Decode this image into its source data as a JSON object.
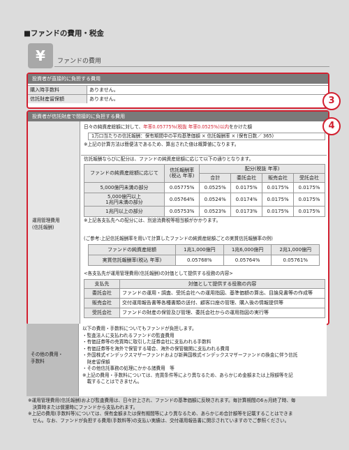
{
  "section_title": "■ファンドの費用・税金",
  "icon": "yen-icon",
  "fee_heading": "ファンドの費用",
  "direct": {
    "header": "投資者が直接的に負担する費用",
    "rows": [
      {
        "label": "購入時手数料",
        "value": "ありません。"
      },
      {
        "label": "信託財産留保額",
        "value": "ありません。"
      }
    ],
    "badge": "3"
  },
  "indirect": {
    "header": "投資者が信託財産で間接的に負担する費用",
    "badge": "4",
    "left_label": "運用管理費用\n(信託報酬)",
    "line1_pre": "日々の純資産総額に対して、",
    "line1_red": "年率0.05775%(税抜 年率0.0525%)以内",
    "line1_post": "をかけた額",
    "formula": "1万口当たりの信託報酬：保有期間中の平均基準価額 × 信託報酬率 × (保有日数／ 365)",
    "note1": "※上記の計算方法は簡便法であるため、算出された値は概算値になります。",
    "note2": "信託報酬ならびに配分は、ファンドの純資産総額に応じて以下の通りとなります。",
    "t1": {
      "h_nav": "ファンドの純資産総額に応じて",
      "h_rate": "信託報酬率\n(税込 年率)",
      "h_alloc": "配分(税抜 年率)",
      "h_cols": [
        "合計",
        "委託会社",
        "販売会社",
        "受託会社"
      ],
      "rows": [
        [
          "5,000億円未満の部分",
          "0.05775%",
          "0.0525%",
          "0.0175%",
          "0.0175%",
          "0.0175%"
        ],
        [
          "5,000億円以上\n1兆円未満の部分",
          "0.05764%",
          "0.0524%",
          "0.0174%",
          "0.0175%",
          "0.0175%"
        ],
        [
          "1兆円以上の部分",
          "0.05753%",
          "0.0523%",
          "0.0173%",
          "0.0175%",
          "0.0175%"
        ]
      ]
    },
    "note3": "※上記各支払先への配分には、別途消費税等相当額がかかります。",
    "note4": "(ご参考:上記信託報酬率を用いて計算したファンドの純資産総額ごとの実質信託報酬率の例)",
    "t2": {
      "head": [
        "ファンドの純資産総額",
        "1兆1,000億円",
        "1兆6,000億円",
        "2兆1,000億円"
      ],
      "row": [
        "実質信託報酬率(税込 年率)",
        "0.05768%",
        "0.05764%",
        "0.05761%"
      ]
    },
    "note5": "<各支払先が運用管理費用(信託報酬)の対価として提供する役務の内容>",
    "t3": {
      "head": [
        "支払先",
        "対価として提供する役務の内容"
      ],
      "rows": [
        [
          "委託会社",
          "ファンドの運用・調査、受託会社への運用指図、基準価額の算出、目論見書等の作成等"
        ],
        [
          "販売会社",
          "交付運用報告書等各種書類の送付、顧客口座の管理、購入後の情報提供等"
        ],
        [
          "受託会社",
          "ファンドの財産の保管及び管理、委託会社からの運用指図の実行等"
        ]
      ]
    }
  },
  "other": {
    "label": "その他の費用・\n手数料",
    "lines": [
      "以下の費用・手数料についてもファンドが負担します。",
      "・監査法人に支払われるファンドの監査費用",
      "・有価証券等の売買時に取引した証券会社に支払われる手数料",
      "・有価証券等を海外で保管する場合、海外の保管機関に支払われる費用",
      "・外国株式インデックスマザーファンドおよび新興国株式インデックスマザーファンドの換金に伴う信託",
      "　財産留保額",
      "・その他信託事務の処理にかかる諸費用　等",
      "※上記の費用・手数料については、売買条件等により異なるため、あらかじめ金額または上限額等を記",
      "　載することはできません。"
    ]
  },
  "footnotes": [
    "※運用管理費用(信託報酬)および監査費用は、日々計上され、ファンドの基準価額に反映されます。毎計算期間の6ヵ月終了時、毎",
    "　決算時または償還時にファンドから支払われます。",
    "※上記の費用(手数料等)については、保有金額または保有期間等により異なるため、あらかじめ合計額等を記載することはできま",
    "　せん。なお、ファンドが負担する費用(手数料等)の支払い実績は、交付運用報告書に開示されていますのでご参照ください。"
  ]
}
